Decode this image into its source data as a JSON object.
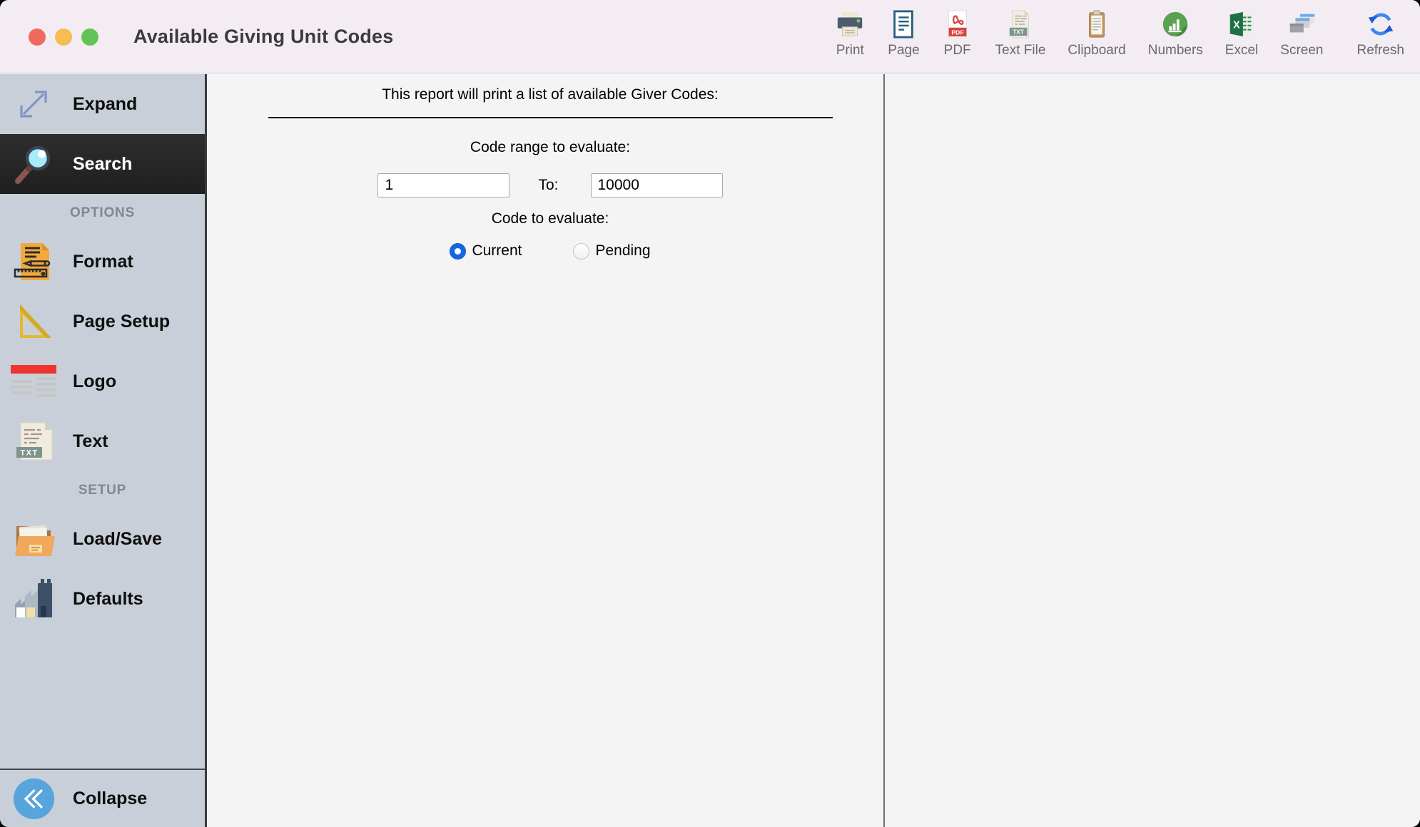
{
  "window": {
    "title": "Available Giving Unit Codes"
  },
  "toolbar": {
    "items": [
      {
        "label": "Print",
        "icon": "printer-icon"
      },
      {
        "label": "Page",
        "icon": "page-icon"
      },
      {
        "label": "PDF",
        "icon": "pdf-icon"
      },
      {
        "label": "Text File",
        "icon": "text-file-icon"
      },
      {
        "label": "Clipboard",
        "icon": "clipboard-icon"
      },
      {
        "label": "Numbers",
        "icon": "numbers-icon"
      },
      {
        "label": "Excel",
        "icon": "excel-icon"
      },
      {
        "label": "Screen",
        "icon": "screen-icon"
      },
      {
        "label": "Refresh",
        "icon": "refresh-icon"
      }
    ]
  },
  "icons": {
    "pdf_badge": "PDF",
    "txt_badge": "TXT",
    "excel_letter": "X"
  },
  "sidebar": {
    "items": [
      {
        "label": "Expand",
        "type": "action"
      },
      {
        "label": "Search",
        "type": "action",
        "selected": true
      },
      {
        "label": "OPTIONS",
        "type": "section"
      },
      {
        "label": "Format",
        "type": "action"
      },
      {
        "label": "Page Setup",
        "type": "action"
      },
      {
        "label": "Logo",
        "type": "action"
      },
      {
        "label": "Text",
        "type": "action"
      },
      {
        "label": "SETUP",
        "type": "section"
      },
      {
        "label": "Load/Save",
        "type": "action"
      },
      {
        "label": "Defaults",
        "type": "action"
      }
    ],
    "collapse_label": "Collapse"
  },
  "content": {
    "intro": "This report will print a list of available Giver Codes:",
    "range_label": "Code range to evaluate:",
    "range_from": "1",
    "to_label": "To:",
    "range_to": "10000",
    "evaluate_label": "Code to evaluate:",
    "options": [
      {
        "label": "Current",
        "selected": true
      },
      {
        "label": "Pending",
        "selected": false
      }
    ]
  },
  "colors": {
    "titlebar": "#F3EDF3",
    "sidebar": "#C8CFD8",
    "sidebar_selected": "#272727",
    "accent_radio_blue": "#1467E2",
    "collapse_blue": "#57A5DC",
    "content_bg": "#F5F4F4",
    "divider_dark": "#3A3A3E"
  }
}
